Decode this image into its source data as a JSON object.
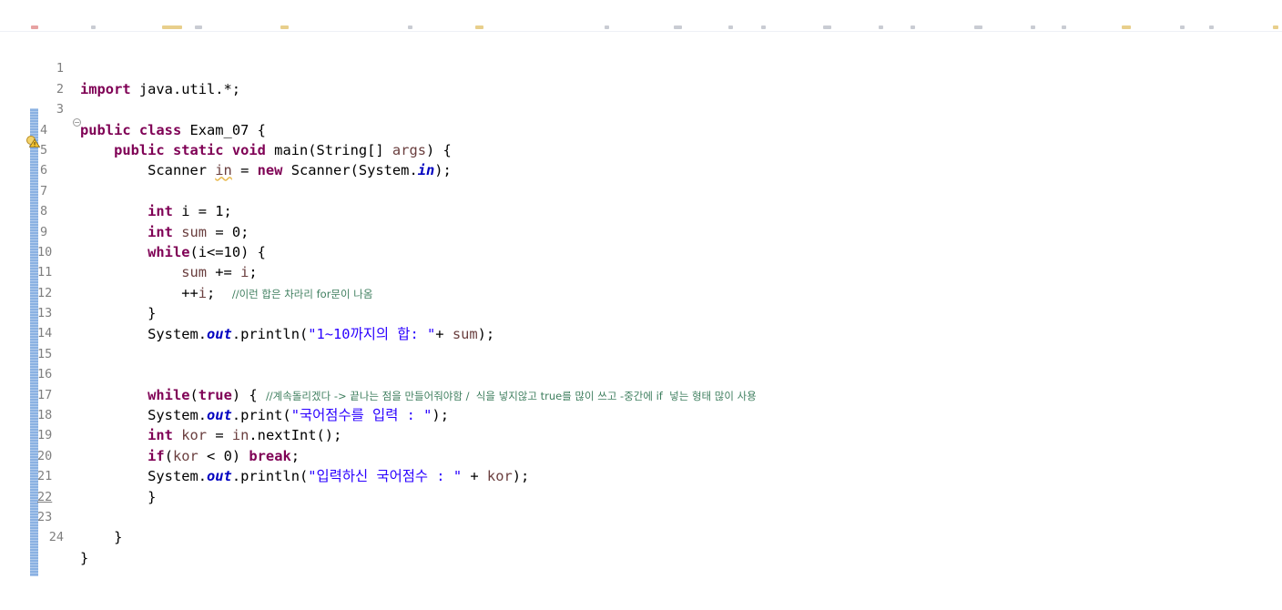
{
  "colors": {
    "keyword": "#7f0055",
    "static_field": "#0000c0",
    "string": "#2a00ff",
    "comment": "#3f7f5f",
    "line_number": "#7f7f7f",
    "gutter_marker": "#8ab1e2"
  },
  "icons": {
    "fold": "fold-collapse-icon",
    "warning": "warning-lightbulb-icon"
  },
  "editor": {
    "line_numbers": [
      "1",
      "2",
      "3",
      "4",
      "5",
      "6",
      "7",
      "8",
      "9",
      "10",
      "11",
      "12",
      "13",
      "14",
      "15",
      "16",
      "17",
      "18",
      "19",
      "20",
      "21",
      "22",
      "23",
      "24"
    ],
    "t": {
      "import": "import",
      "javautil": " java.util.*;",
      "public": "public",
      "class": " class",
      "classname": " Exam_07 {",
      "indent1": "    ",
      "public2": "public",
      "static": " static",
      "void": " void",
      "main_sig": " main(String[] ",
      "args": "args",
      "brace_open": ") {",
      "indent2": "        ",
      "scanner_decl": "Scanner ",
      "in_var": "in",
      "assign": " = ",
      "new": "new",
      "scanner_ctor": " Scanner(System.",
      "in_field": "in",
      "close_semi": ");",
      "int": "int",
      "i_decl": " i = 1;",
      "sum_space": " ",
      "sum": "sum",
      "zero": " = 0;",
      "while": "while",
      "cond": "(i<=10) {",
      "indent3": "            ",
      "sum2": "sum",
      "plusassign": " += ",
      "i_var": "i",
      "semi": ";",
      "inc": "++",
      "i_var2": "i",
      "semi2": ";  ",
      "comment11": "//이런 합은 차라리 for문이 나옴",
      "close_brace": "}",
      "system": "System.",
      "out": "out",
      "println1": ".println(",
      "str13": "\"1~10까지의 합: \"",
      "plus": "+ ",
      "sum3": "sum",
      "end_paren": ");",
      "while2": "while",
      "paren_open": "(",
      "true": "true",
      "paren_brace": ") {",
      "space": " ",
      "comment16": "//계속돌리겠다 -> 끝나는 점을 만들어줘야함 /  식을 넣지않고 true를 많이 쓰고 -중간에 if  넣는 형태 많이 사용",
      "system2": "System.",
      "out2": "out",
      "print": ".print(",
      "str17": "\"국어점수를 입력 : \"",
      "end_paren2": ");",
      "int2": "int",
      "kor_space": " ",
      "kor": "kor",
      "assign2": " = ",
      "in_var2": "in",
      "nextint": ".nextInt();",
      "if": "if",
      "paren2": "(",
      "kor2": "kor",
      "lt0": " < 0) ",
      "break": "break",
      "semi3": ";",
      "system3": "System.",
      "out3": "out",
      "println3": ".println(",
      "str20": "\"입력하신 국어점수 : \"",
      "plus2": " + ",
      "kor3": "kor",
      "end_paren3": ");",
      "close_brace2": "}",
      "close_brace3": "}",
      "close_brace4": "}"
    }
  }
}
